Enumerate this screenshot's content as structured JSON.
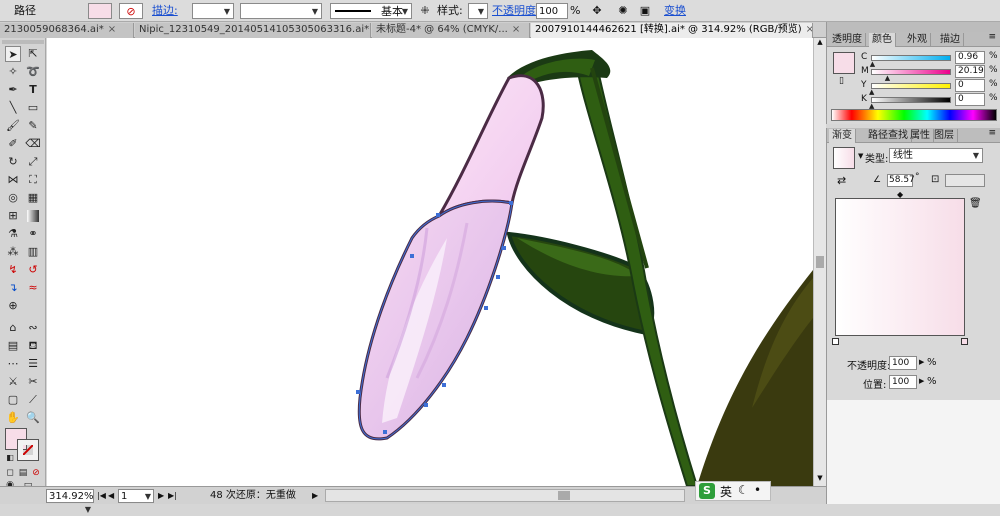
{
  "control_bar": {
    "object_type": "路径",
    "stroke_label": "描边:",
    "stroke_profile": "基本",
    "style_label": "样式:",
    "opacity_label": "不透明度:",
    "opacity_value": "100",
    "opacity_unit": "%",
    "transform_label": "变换"
  },
  "doc_tabs": [
    {
      "label": "2130059068364.ai*",
      "close": "×"
    },
    {
      "label": "Nipic_12310549_20140514105305063316.ai*",
      "close": "×"
    },
    {
      "label": "未标题-4* @ 64% (CMYK/...",
      "close": "×"
    },
    {
      "label": "2007910144462621   [转换].ai* @ 314.92% (RGB/预览)",
      "close": "×"
    }
  ],
  "status_bar": {
    "zoom": "314.92%",
    "page": "1",
    "undo_text": "48 次还原：无重做"
  },
  "color_panel": {
    "tabs": [
      "透明度",
      "颜色",
      "外观",
      "描边"
    ],
    "active_tab": "颜色",
    "fill_color": "#f7dde8",
    "channels": [
      {
        "label": "C",
        "value": "0.96",
        "unit": "%",
        "level": 0.0096
      },
      {
        "label": "M",
        "value": "20.19",
        "unit": "%",
        "level": 0.2019
      },
      {
        "label": "Y",
        "value": "0",
        "unit": "%",
        "level": 0
      },
      {
        "label": "K",
        "value": "0",
        "unit": "%",
        "level": 0
      }
    ]
  },
  "gradient_panel": {
    "tabs": [
      "渐变",
      "路径查找",
      "属性",
      "图层"
    ],
    "active_tab": "渐变",
    "type_label": "类型:",
    "type_value": "线性",
    "angle_value": "58.57",
    "angle_unit": "°",
    "opacity_label": "不透明度:",
    "opacity_value": "100",
    "opacity_unit": "%",
    "position_label": "位置:",
    "position_value": "100",
    "position_unit": "%",
    "gradient_start": "#ffffff",
    "gradient_end": "#f7dde8"
  },
  "ime": {
    "logo": "S",
    "mode": "英",
    "moon": "☾",
    "dot": "•"
  },
  "colors": {
    "stem": "#2f5e12",
    "stem_dark": "#1b3a14",
    "leaf_dark": "#3a3a0f",
    "bud_pink": "#e8c6ec",
    "bud_outline": "#4b2b45",
    "selection": "#3d6fd6"
  }
}
